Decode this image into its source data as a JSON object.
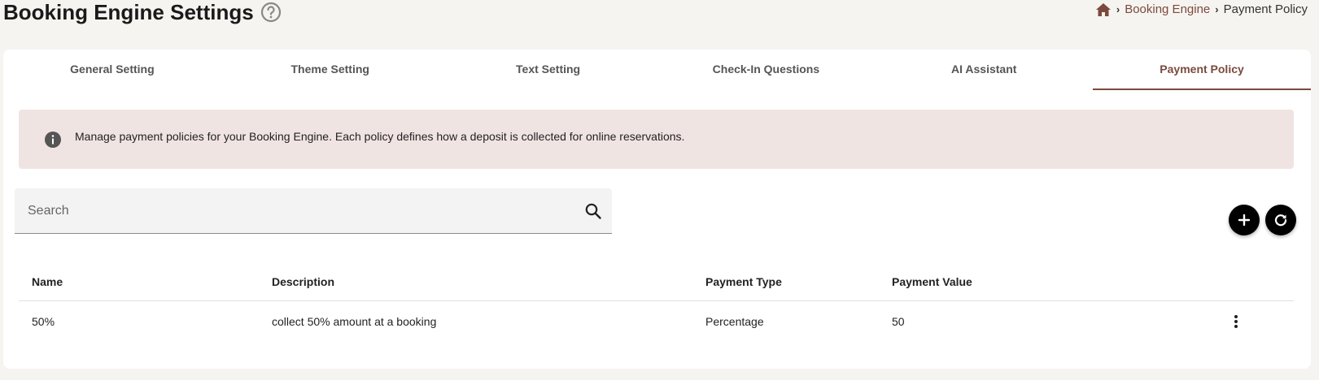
{
  "header": {
    "title": "Booking Engine Settings",
    "help_icon": "help-circle-icon"
  },
  "breadcrumb": {
    "home_icon": "home-icon",
    "items": [
      "Booking Engine",
      "Payment Policy"
    ]
  },
  "tabs": [
    {
      "label": "General Setting",
      "active": false
    },
    {
      "label": "Theme Setting",
      "active": false
    },
    {
      "label": "Text Setting",
      "active": false
    },
    {
      "label": "Check-In Questions",
      "active": false
    },
    {
      "label": "AI Assistant",
      "active": false
    },
    {
      "label": "Payment Policy",
      "active": true
    }
  ],
  "info": {
    "icon": "info-icon",
    "text": "Manage payment policies for your Booking Engine. Each policy defines how a deposit is collected for online reservations."
  },
  "search": {
    "placeholder": "Search",
    "value": "",
    "icon": "search-icon"
  },
  "actions": {
    "add_icon": "plus-icon",
    "refresh_icon": "refresh-icon"
  },
  "table": {
    "columns": [
      "Name",
      "Description",
      "Payment Type",
      "Payment Value"
    ],
    "rows": [
      {
        "name": "50%",
        "description": "collect 50% amount at a booking",
        "payment_type": "Percentage",
        "payment_value": "50"
      }
    ]
  },
  "colors": {
    "accent": "#7a4a3e",
    "banner_bg": "#f0e4e2",
    "page_bg": "#f6f4f0"
  }
}
